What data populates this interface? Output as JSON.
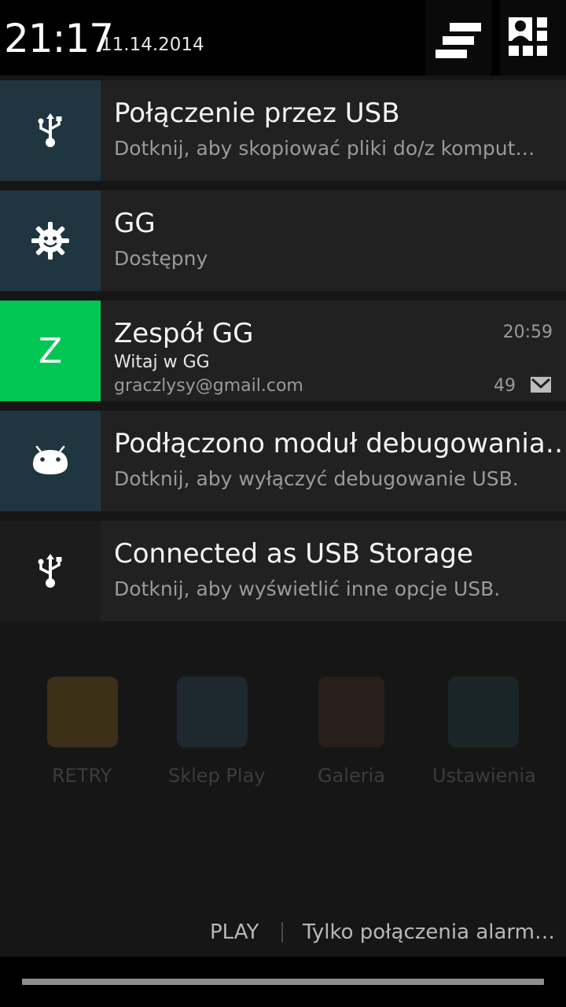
{
  "header": {
    "time": "21:17",
    "date": "11.14.2014",
    "clear_icon": "clear-all-icon",
    "settings_icon": "quick-settings-icon"
  },
  "home_screen": {
    "app_labels": [
      "RETRY",
      "Sklep Play",
      "Galeria",
      "Ustawienia"
    ]
  },
  "notifications": [
    {
      "id": "usb-connection",
      "title": "Połączenie przez USB",
      "text": "Dotknij, aby skopiować pliki do/z komput…",
      "icon": "usb-icon",
      "icon_bg": "#1f3640"
    },
    {
      "id": "gg-status",
      "title": "GG",
      "text": "Dostępny",
      "icon": "gg-sun-icon",
      "icon_bg": "#1f3640"
    },
    {
      "id": "gg-email",
      "title": "Zespół GG",
      "subtitle": "Witaj w GG",
      "info": "graczlysy@gmail.com",
      "time": "20:59",
      "count": "49",
      "avatar_letter": "Z",
      "icon": "mail-icon",
      "icon_bg": "#00c653"
    },
    {
      "id": "usb-debugging",
      "title": "Podłączono moduł debugowania…",
      "text": "Dotknij, aby wyłączyć debugowanie USB.",
      "icon": "android-icon",
      "icon_bg": "#1f3640"
    },
    {
      "id": "usb-storage",
      "title": "Connected as USB Storage",
      "text": "Dotknij, aby wyświetlić inne opcje USB.",
      "icon": "usb-icon",
      "icon_bg": "#1c1c1c"
    }
  ],
  "footer": {
    "carrier_1": "PLAY",
    "carrier_2": "Tylko połączenia alarm…"
  },
  "colors": {
    "notification_bg": "#212121",
    "accent_green": "#00c653",
    "icon_box": "#1f3640"
  }
}
